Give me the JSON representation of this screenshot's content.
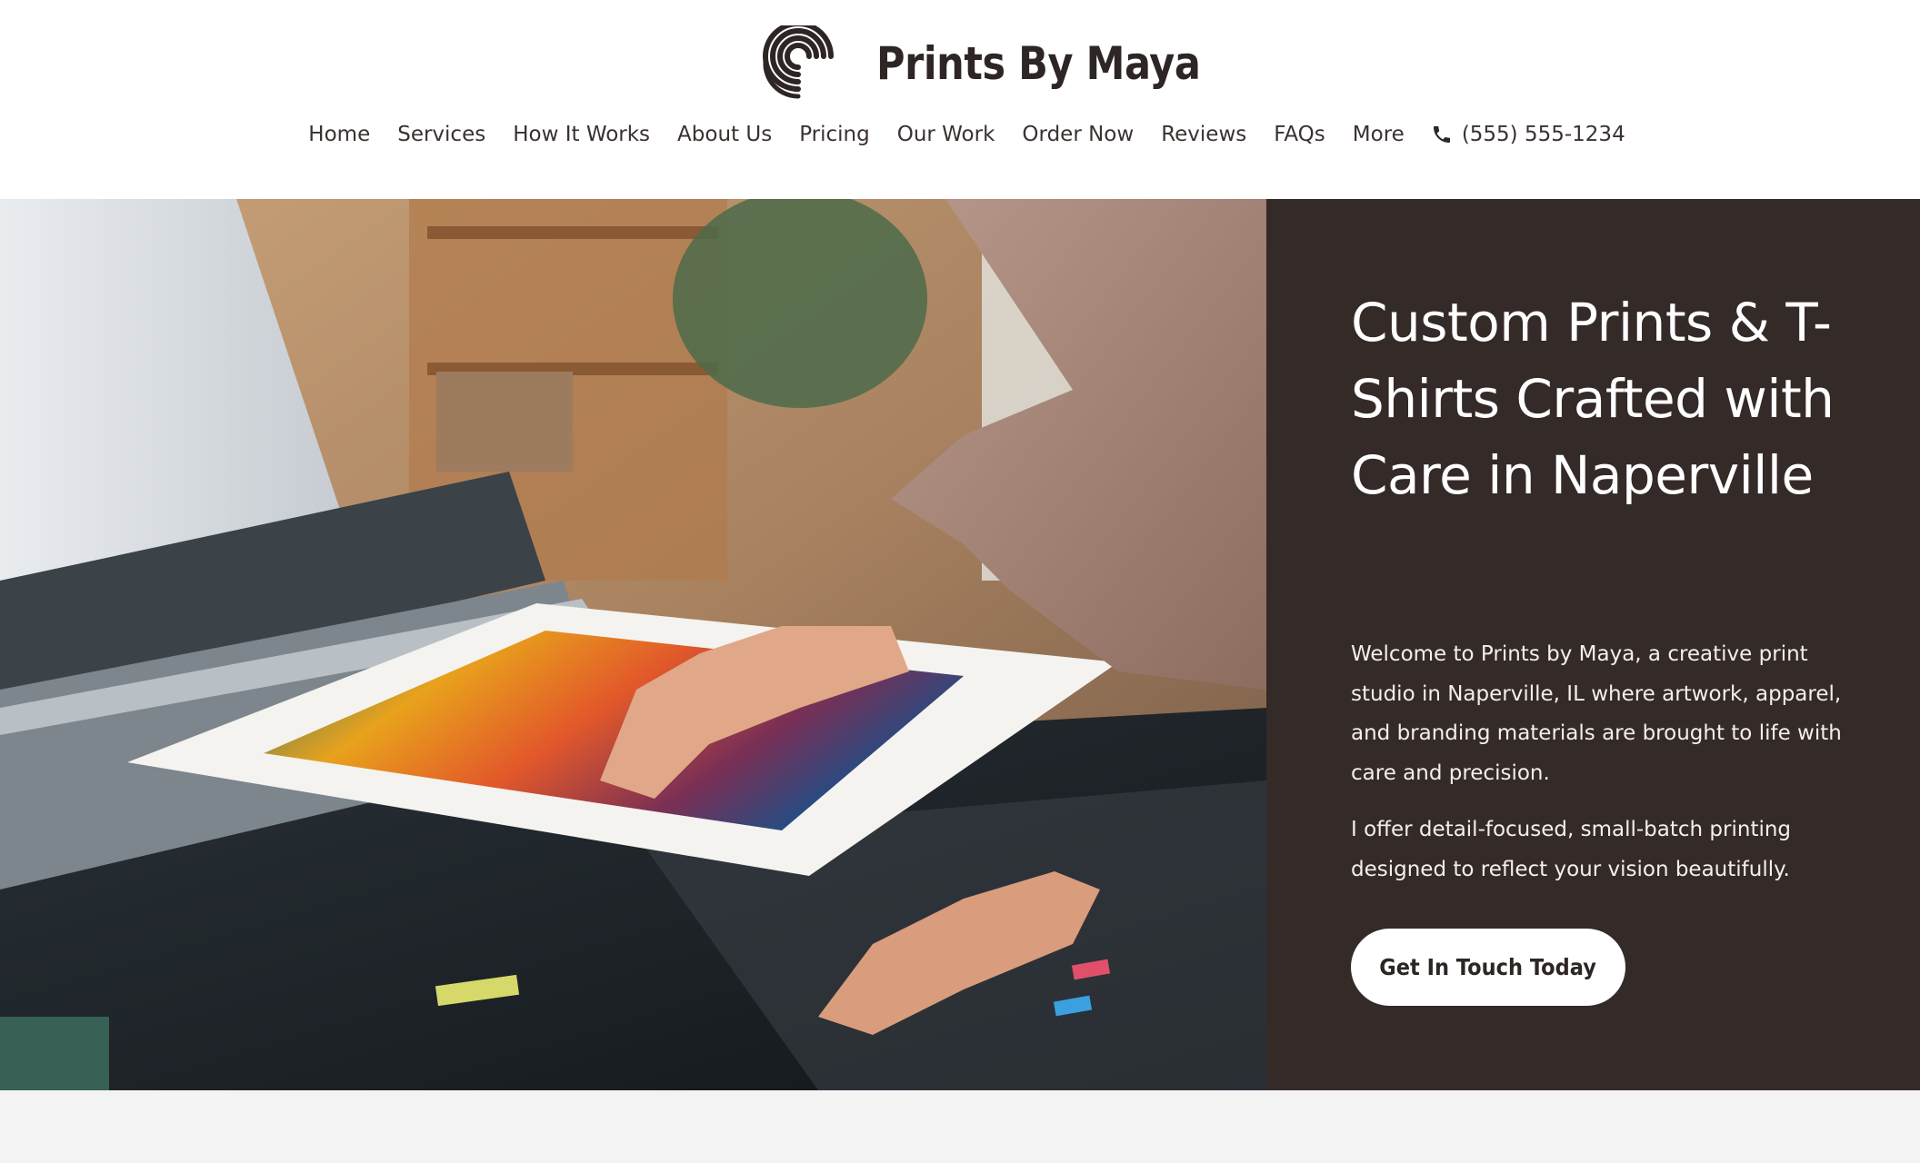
{
  "brand": {
    "name": "Prints By Maya",
    "logo_icon": "spiral-logo-icon"
  },
  "nav": {
    "items": [
      {
        "label": "Home"
      },
      {
        "label": "Services"
      },
      {
        "label": "How It Works"
      },
      {
        "label": "About Us"
      },
      {
        "label": "Pricing"
      },
      {
        "label": "Our Work"
      },
      {
        "label": "Order Now"
      },
      {
        "label": "Reviews"
      },
      {
        "label": "FAQs"
      },
      {
        "label": "More"
      }
    ],
    "phone_icon": "phone-icon",
    "phone": "(555) 555-1234"
  },
  "hero": {
    "title": "Custom Prints & T-Shirts Crafted with Care in Naperville",
    "paragraph1": "Welcome to Prints by Maya, a creative print studio in Naperville, IL where artwork, apparel, and branding materials are brought to life with care and precision.",
    "paragraph2": "I offer detail-focused, small-batch printing designed to reflect your vision beautifully.",
    "cta_label": "Get In Touch Today"
  },
  "colors": {
    "panel_background": "#342a28",
    "header_background": "#ffffff",
    "text_dark": "#2e2624",
    "below_background": "#f3f3f3"
  }
}
